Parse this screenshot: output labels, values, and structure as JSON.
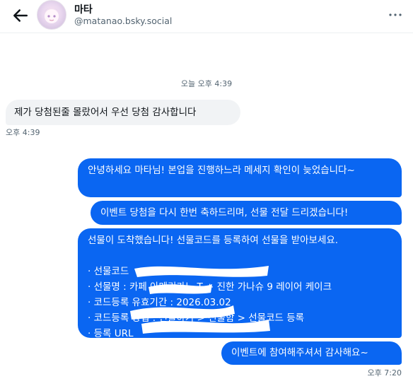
{
  "header": {
    "name": "마타",
    "handle": "@matanao.bsky.social"
  },
  "separator": {
    "label": "오늘 오후 4:39"
  },
  "messages": {
    "incoming": {
      "text": "제가 당첨된줄 몰랐어서 우선 당첨 감사합니다",
      "time": "오후 4:39"
    },
    "outgoing1": {
      "text": "안녕하세요 마타님! 본업을 진행하느라 메세지 확인이 늦었습니다~"
    },
    "outgoing2": {
      "text": "이벤트 당첨을 다시 한번 축하드리며, 선물 전달 드리겠습니다!"
    },
    "outgoing3": {
      "lines": [
        "선물이 도착했습니다! 선물코드를 등록하여 선물을 받아보세요.",
        "",
        "· 선물코드",
        "· 선물명 : 카페 아메리카노 T + 진한 가나슈 9 레이어 케이크",
        "· 코드등록 유효기간 : 2026.03.02",
        "· 코드등록 방법 : 선물하기 > 선물함 > 선물코드 등록",
        "· 등록 URL"
      ]
    },
    "outgoing4": {
      "text": "이벤트에 참여해주셔서 감사해요~",
      "time": "오후 7:20"
    }
  },
  "colors": {
    "outgoing_bubble": "#0a66f2",
    "incoming_bubble": "#f1f3f5",
    "secondary_text": "#536471"
  },
  "icons": {
    "back": "arrow-left-icon",
    "more": "more-horizontal-icon"
  }
}
